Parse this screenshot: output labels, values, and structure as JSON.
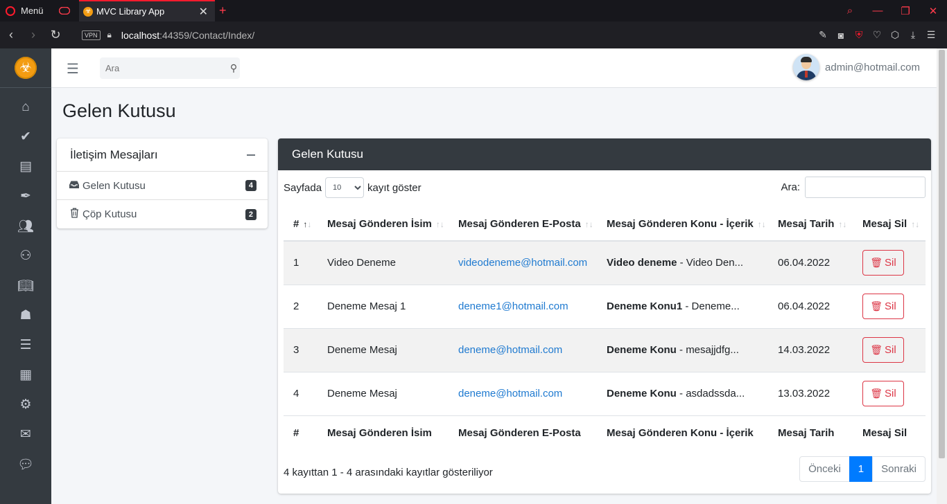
{
  "browser": {
    "menu_label": "Menü",
    "tab_title": "MVC Library App",
    "url_host": "localhost",
    "url_rest": ":44359/Contact/Index/",
    "vpn_label": "VPN"
  },
  "topnav": {
    "search_placeholder": "Ara",
    "user_email": "admin@hotmail.com"
  },
  "sidebar": {
    "icons": [
      "home-icon",
      "tasks-icon",
      "book-icon",
      "feather-icon",
      "users-icon",
      "people-icon",
      "open-book-icon",
      "reader-icon",
      "list-icon",
      "building-icon",
      "cogs-icon",
      "envelope-icon",
      "comment-icon"
    ]
  },
  "page": {
    "title": "Gelen Kutusu"
  },
  "left_card": {
    "title": "İletişim Mesajları",
    "items": [
      {
        "label": "Gelen Kutusu",
        "count": "4",
        "icon": "inbox-icon"
      },
      {
        "label": "Çöp Kutusu",
        "count": "2",
        "icon": "trash-icon"
      }
    ]
  },
  "right_card": {
    "title": "Gelen Kutusu",
    "length_prefix": "Sayfada",
    "length_value": "10",
    "length_suffix": "kayıt göster",
    "search_label": "Ara:",
    "columns": [
      "#",
      "Mesaj Gönderen İsim",
      "Mesaj Gönderen E-Posta",
      "Mesaj Gönderen Konu - İçerik",
      "Mesaj Tarih",
      "Mesaj Sil"
    ],
    "rows": [
      {
        "id": "1",
        "name": "Video Deneme",
        "email": "videodeneme@hotmail.com",
        "subject": "Video deneme",
        "preview": " - Video Den...",
        "date": "06.04.2022",
        "action": "Sil"
      },
      {
        "id": "2",
        "name": "Deneme Mesaj 1",
        "email": "deneme1@hotmail.com",
        "subject": "Deneme Konu1",
        "preview": " - Deneme...",
        "date": "06.04.2022",
        "action": "Sil"
      },
      {
        "id": "3",
        "name": "Deneme Mesaj",
        "email": "deneme@hotmail.com",
        "subject": "Deneme Konu",
        "preview": " - mesajjdfg...",
        "date": "14.03.2022",
        "action": "Sil"
      },
      {
        "id": "4",
        "name": "Deneme Mesaj",
        "email": "deneme@hotmail.com",
        "subject": "Deneme Konu",
        "preview": " - asdadssda...",
        "date": "13.03.2022",
        "action": "Sil"
      }
    ],
    "info": "4 kayıttan 1 - 4 arasındaki kayıtlar gösteriliyor",
    "pager": {
      "prev": "Önceki",
      "current": "1",
      "next": "Sonraki"
    }
  }
}
